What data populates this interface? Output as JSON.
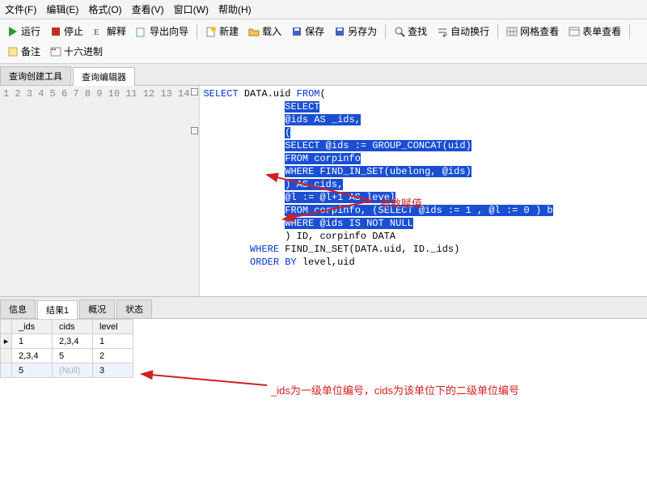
{
  "menu": {
    "file": "文件(F)",
    "edit": "编辑(E)",
    "format": "格式(O)",
    "view": "查看(V)",
    "window": "窗口(W)",
    "help": "帮助(H)"
  },
  "toolbar": {
    "run": "运行",
    "stop": "停止",
    "explain": "解释",
    "export_wizard": "导出向导",
    "new": "新建",
    "load": "载入",
    "save": "保存",
    "save_as": "另存为",
    "find": "查找",
    "autowrap": "自动换行",
    "grid_view": "网格查看",
    "form_view": "表单查看",
    "comment": "备注",
    "hex": "十六进制"
  },
  "tabs": {
    "builder": "查询创建工具",
    "editor": "查询编辑器"
  },
  "code": {
    "lines": [
      "SELECT DATA.uid FROM(",
      "              SELECT",
      "              @ids AS _ids,",
      "              (",
      "              SELECT @ids := GROUP_CONCAT(uid)",
      "              FROM corpinfo",
      "              WHERE FIND_IN_SET(ubelong, @ids)",
      "              ) AS cids,",
      "              @l := @l+1 AS level",
      "              FROM corpinfo, (SELECT @ids := 1 , @l := 0 ) b",
      "              WHERE @ids IS NOT NULL",
      "              ) ID, corpinfo DATA",
      "        WHERE FIND_IN_SET(DATA.uid, ID._ids)",
      "        ORDER BY level,uid"
    ]
  },
  "annotations": {
    "a1": "参数赋值",
    "a2": "_ids为一级单位编号，cids为该单位下的二级单位编号"
  },
  "result_tabs": {
    "info": "信息",
    "res1": "结果1",
    "profile": "概况",
    "status": "状态"
  },
  "grid": {
    "cols": [
      "_ids",
      "cids",
      "level"
    ],
    "rows": [
      {
        "ids": "1",
        "cids": "2,3,4",
        "level": "1",
        "cursor": true
      },
      {
        "ids": "2,3,4",
        "cids": "5",
        "level": "2"
      },
      {
        "ids": "5",
        "cids": "(Null)",
        "level": "3",
        "null_cids": true,
        "sel": true
      }
    ]
  }
}
